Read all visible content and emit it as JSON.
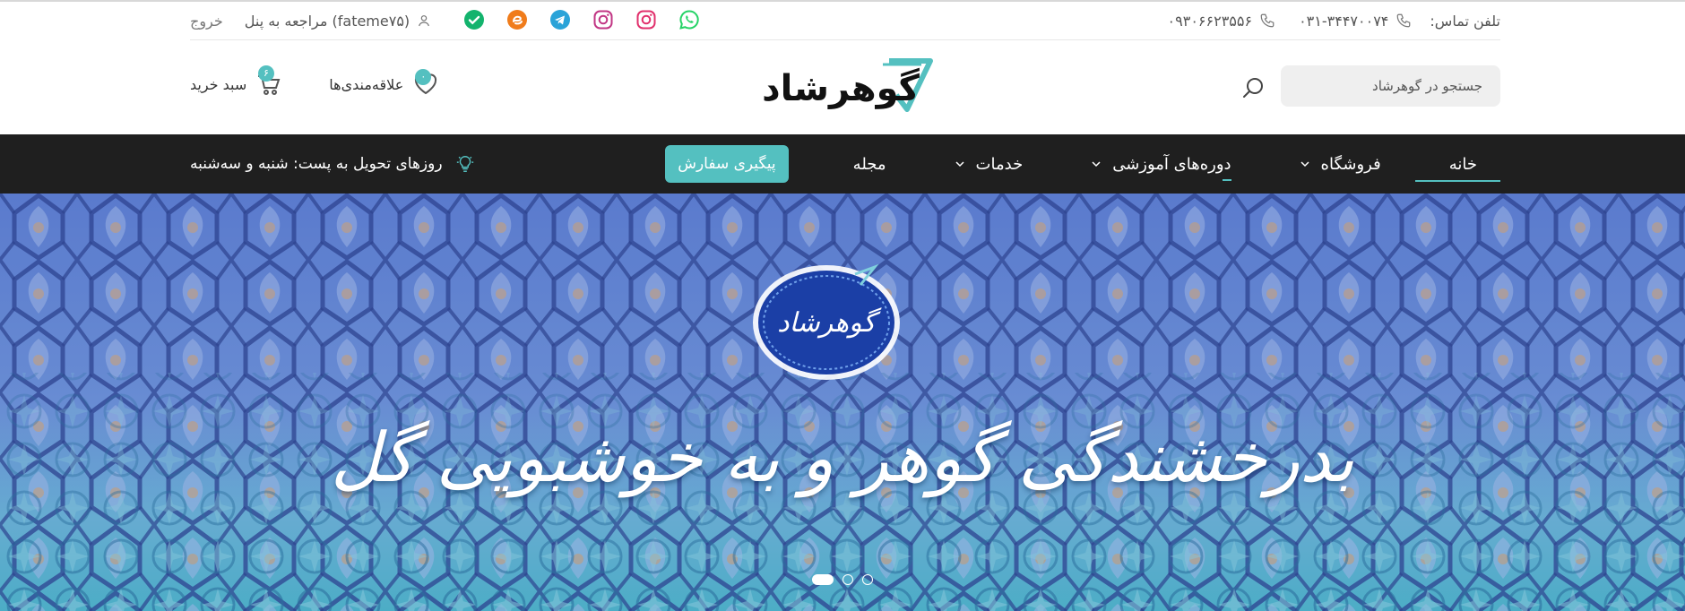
{
  "topbar": {
    "phone_label": "تلفن تماس:",
    "phones": [
      "۰۳۱-۳۴۴۷۰۰۷۴",
      "۰۹۳۰۶۶۲۳۵۵۶"
    ],
    "social": [
      {
        "icon": "whatsapp-icon",
        "color": "#25d366"
      },
      {
        "icon": "instagram-icon",
        "color": "#e1306c"
      },
      {
        "icon": "instagram-icon",
        "color": "#c13584"
      },
      {
        "icon": "telegram-icon",
        "color": "#2aa3d8"
      },
      {
        "icon": "eitaa-icon",
        "color": "#f07c1b"
      },
      {
        "icon": "check-icon",
        "color": "#13b36d"
      }
    ],
    "panel_link": "مراجعه به پنل (fateme۷۵)",
    "logout": "خروج"
  },
  "header": {
    "search_placeholder": "جستجو در گوهرشاد",
    "logo_text": "گوهرشاد",
    "wishlist_label": "علاقه‌مندی‌ها",
    "wishlist_count": "۰",
    "cart_label": "سبد خرید",
    "cart_count": "۶"
  },
  "nav": {
    "items": [
      {
        "label": "خانه",
        "active": true,
        "has_dropdown": false
      },
      {
        "label": "فروشگاه",
        "active": false,
        "has_dropdown": true
      },
      {
        "label": "دوره‌های آموزشی",
        "active": false,
        "has_dropdown": true
      },
      {
        "label": "خدمات",
        "active": false,
        "has_dropdown": true
      },
      {
        "label": "مجله",
        "active": false,
        "has_dropdown": false
      }
    ],
    "track_order": "پیگیری سفارش",
    "delivery_text": "روزهای تحویل به پست: شنبه و سه‌شنبه"
  },
  "hero": {
    "headline": "بدرخشندگی گوهر و به خوشبویی گل",
    "emblem_text": "گوهرشاد",
    "slides": 3,
    "active_slide": 0
  },
  "colors": {
    "accent": "#54c0c0",
    "nav_bg": "#1f1f1f"
  }
}
